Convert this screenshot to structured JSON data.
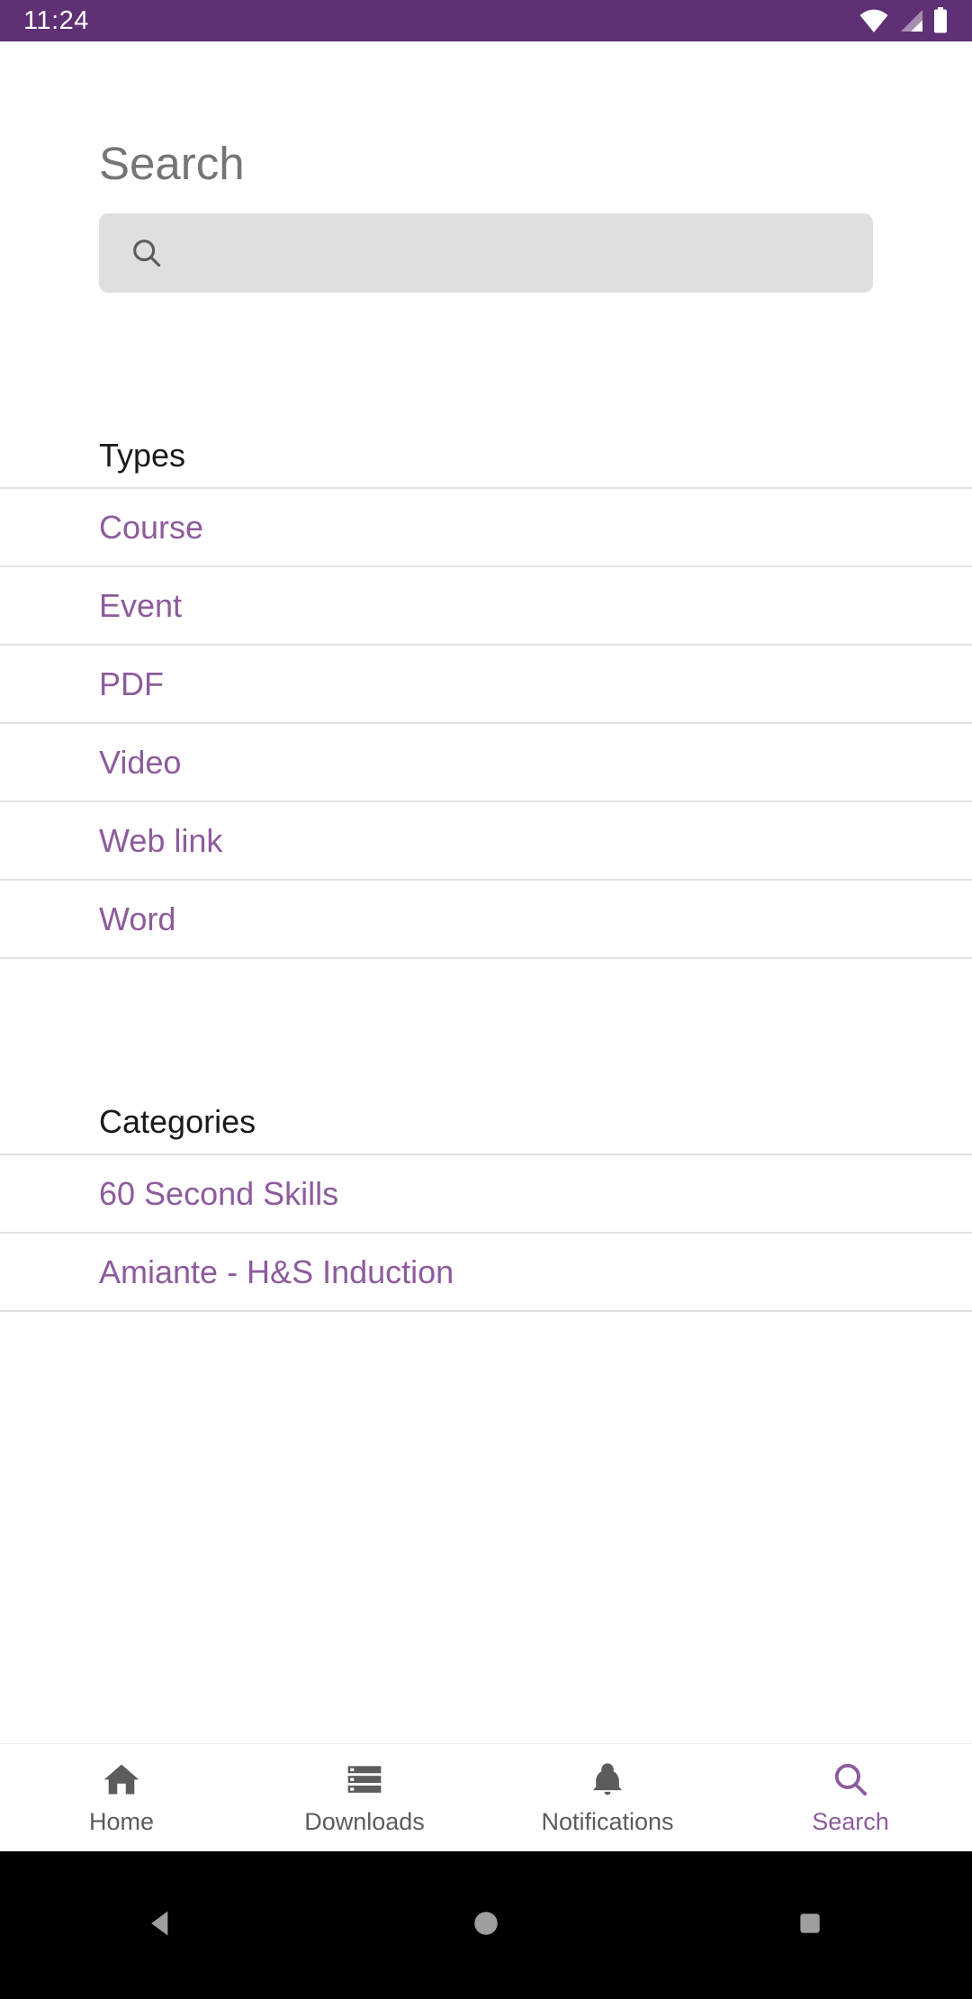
{
  "status_bar": {
    "time": "11:24",
    "icons": [
      "wifi-icon",
      "cellular-signal-icon",
      "battery-icon"
    ],
    "background_color": "#5F3074"
  },
  "theme": {
    "accent_purple": "#8D5B9D",
    "status_purple": "#5F3074",
    "search_field_bg": "#DFDFDF",
    "divider": "#E2E2E2",
    "heading_gray": "#757575"
  },
  "search": {
    "title": "Search",
    "input_value": "",
    "placeholder": "",
    "icon": "search-icon"
  },
  "sections": [
    {
      "title": "Types",
      "items": [
        {
          "label": "Course"
        },
        {
          "label": "Event"
        },
        {
          "label": "PDF"
        },
        {
          "label": "Video"
        },
        {
          "label": "Web link"
        },
        {
          "label": "Word"
        }
      ]
    },
    {
      "title": "Categories",
      "items": [
        {
          "label": "60 Second Skills"
        },
        {
          "label": "Amiante - H&S Induction"
        }
      ]
    }
  ],
  "bottom_nav": {
    "items": [
      {
        "label": "Home",
        "icon": "home-icon",
        "active": false
      },
      {
        "label": "Downloads",
        "icon": "downloads-list-icon",
        "active": false
      },
      {
        "label": "Notifications",
        "icon": "bell-icon",
        "active": false
      },
      {
        "label": "Search",
        "icon": "search-icon",
        "active": true
      }
    ]
  },
  "system_nav": {
    "buttons": [
      {
        "name": "back-button",
        "icon": "triangle-back-icon"
      },
      {
        "name": "home-button",
        "icon": "circle-home-icon"
      },
      {
        "name": "recents-button",
        "icon": "square-recents-icon"
      }
    ]
  }
}
